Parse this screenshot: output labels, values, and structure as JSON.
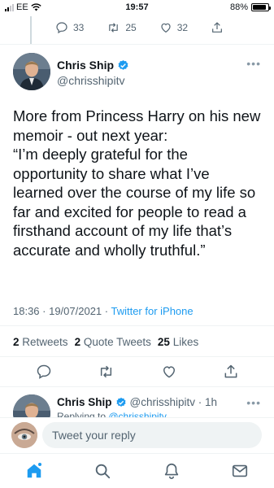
{
  "status_bar": {
    "carrier": "EE",
    "time": "19:57",
    "battery_percent": "88%",
    "battery_level": 0.88
  },
  "previous_tweet": {
    "replies": "33",
    "retweets": "25",
    "likes": "32"
  },
  "tweet": {
    "author_name": "Chris Ship",
    "author_handle": "@chrisshipitv",
    "verified": true,
    "text_lines": [
      "More from Princess Harry on his new",
      "memoir - out next year:",
      "“I’m deeply grateful for the",
      "opportunity to share what I’ve",
      "learned over the course of my life so",
      "far and excited for people to read a",
      "firsthand account of my life that’s",
      "accurate and wholly truthful.”"
    ],
    "timestamp": "18:36 · 19/07/2021 · ",
    "source": "Twitter for iPhone",
    "retweet_count": "2",
    "retweet_label": "Retweets",
    "quote_count": "2",
    "quote_label": "Quote Tweets",
    "like_count": "25",
    "like_label": "Likes"
  },
  "reply": {
    "author_name": "Chris Ship",
    "author_handle": "@chrisshipitv · 1h",
    "replying_prefix": "Replying to ",
    "replying_to": "@chrisshipitv"
  },
  "compose": {
    "placeholder": "Tweet your reply"
  },
  "tabs": [
    "home-icon",
    "search-icon",
    "notifications-icon",
    "messages-icon"
  ],
  "colors": {
    "accent": "#1d9bf0",
    "text": "#0f1419",
    "muted": "#536471"
  }
}
